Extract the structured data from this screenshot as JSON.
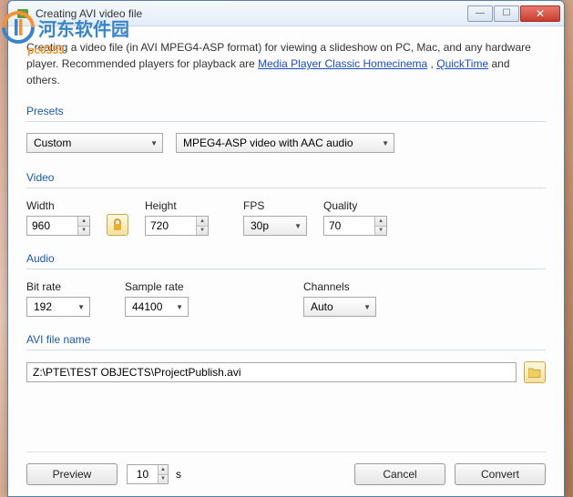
{
  "window": {
    "title": "Creating AVI video file"
  },
  "intro": {
    "line1a": "Creating a video file (in AVI MPEG4-ASP format) for viewing a slideshow on PC, Mac, and any hardware",
    "line2a": "player. Recommended players for playback are ",
    "link1": "Media Player Classic Homecinema",
    "sep": " , ",
    "link2": "QuickTime",
    "line2b": " and others."
  },
  "sections": {
    "presets": "Presets",
    "video": "Video",
    "audio": "Audio",
    "filename": "AVI file name"
  },
  "presets": {
    "preset": "Custom",
    "codec": "MPEG4-ASP video with AAC audio"
  },
  "video": {
    "width_label": "Width",
    "width": "960",
    "height_label": "Height",
    "height": "720",
    "fps_label": "FPS",
    "fps": "30p",
    "quality_label": "Quality",
    "quality": "70"
  },
  "audio": {
    "bitrate_label": "Bit rate",
    "bitrate": "192",
    "samplerate_label": "Sample rate",
    "samplerate": "44100",
    "channels_label": "Channels",
    "channels": "Auto"
  },
  "filename": "Z:\\PTE\\TEST OBJECTS\\ProjectPublish.avi",
  "bottom": {
    "preview": "Preview",
    "seconds": "10",
    "seconds_unit": "s",
    "cancel": "Cancel",
    "convert": "Convert"
  },
  "watermark": {
    "text": "河东软件园",
    "sub": "pc0359"
  }
}
